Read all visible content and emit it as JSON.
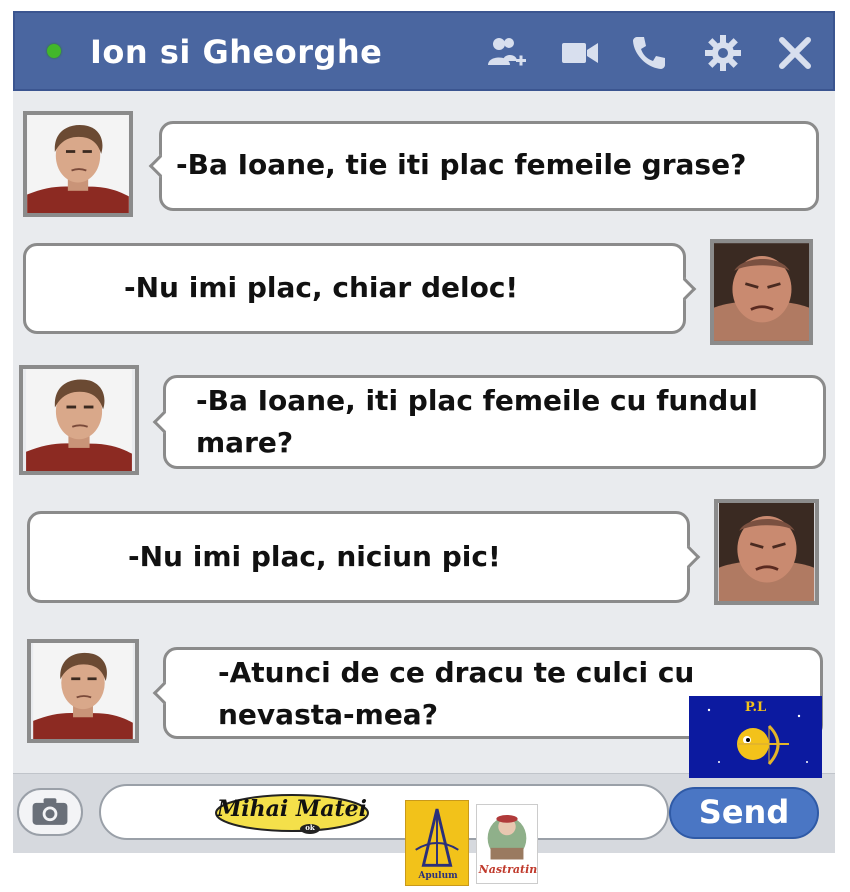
{
  "chat": {
    "title": "Ion si Gheorghe",
    "online": true
  },
  "header_icons": [
    "add-friend-icon",
    "video-camera-icon",
    "phone-icon",
    "gear-icon",
    "close-icon"
  ],
  "messages": [
    {
      "sender": "left",
      "lines": [
        "-Ba Ioane, tie iti plac femeile grase?"
      ]
    },
    {
      "sender": "right",
      "lines": [
        "-Nu imi plac, chiar deloc!"
      ]
    },
    {
      "sender": "left",
      "lines": [
        "-Ba Ioane, iti plac femeile cu fundul",
        "mare?"
      ]
    },
    {
      "sender": "right",
      "lines": [
        "-Nu imi plac, niciun pic!"
      ]
    },
    {
      "sender": "left",
      "lines": [
        "-Atunci de ce dracu te culci cu",
        "nevasta-mea?"
      ]
    }
  ],
  "composer": {
    "input_value": "",
    "send_label": "Send"
  },
  "watermarks": {
    "author_badge": "Mihai Matei",
    "author_badge_sub": "ok",
    "pl_logo": "P.L",
    "apulum_logo": "Apulum",
    "nastratin_logo": "Nastratin"
  },
  "colors": {
    "header": "#4a66a0",
    "online_dot": "#42b72a",
    "send_button": "#4a76c4"
  }
}
